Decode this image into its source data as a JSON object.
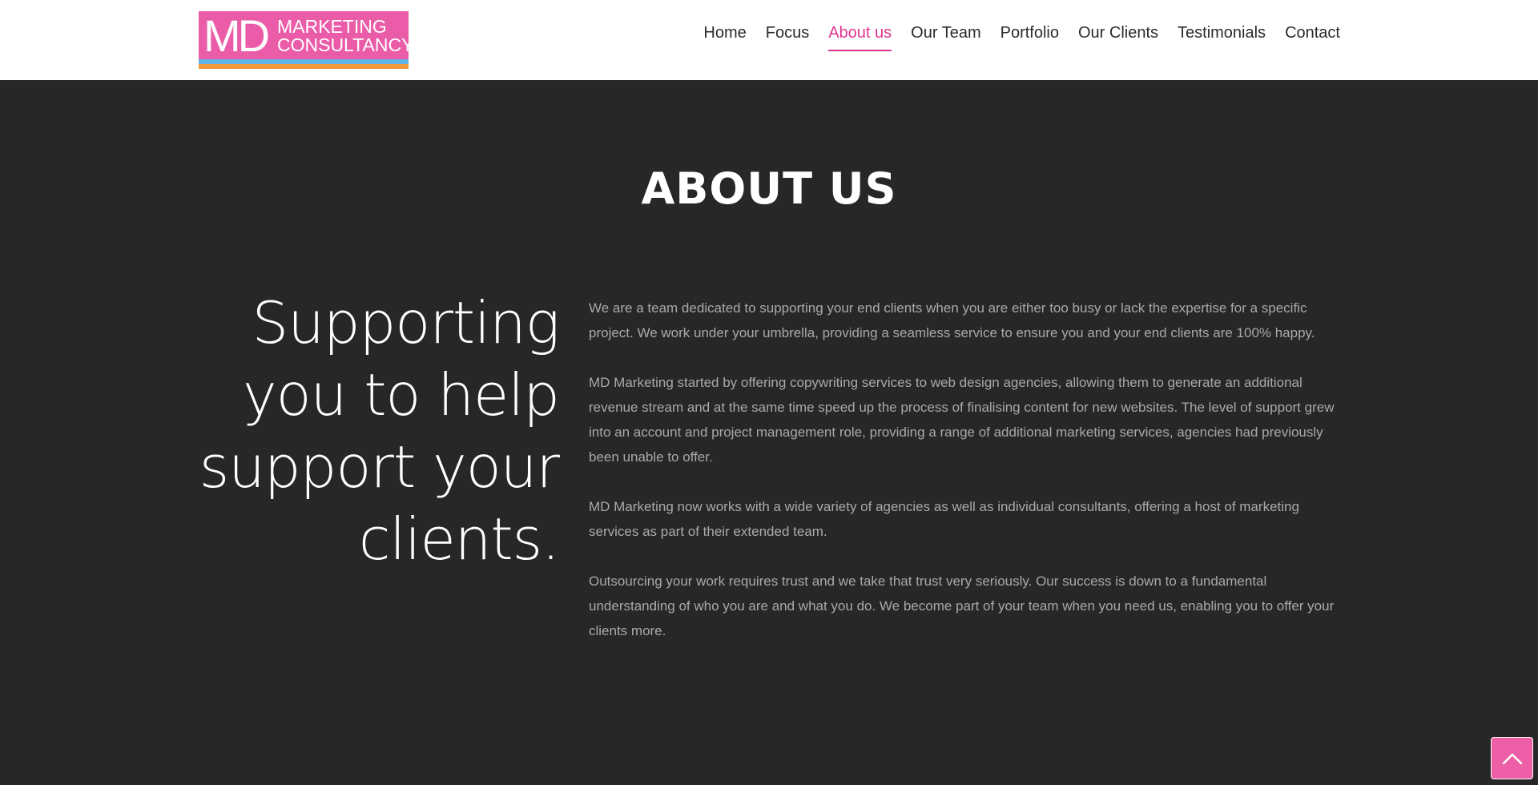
{
  "header": {
    "logo": {
      "big_text": "MD",
      "line1": "MARKETING",
      "line2": "CONSULTANCY"
    },
    "nav": [
      {
        "label": "Home",
        "active": false
      },
      {
        "label": "Focus",
        "active": false
      },
      {
        "label": "About us",
        "active": true
      },
      {
        "label": "Our Team",
        "active": false
      },
      {
        "label": "Portfolio",
        "active": false
      },
      {
        "label": "Our Clients",
        "active": false
      },
      {
        "label": "Testimonials",
        "active": false
      },
      {
        "label": "Contact",
        "active": false
      }
    ]
  },
  "about": {
    "title": "ABOUT US",
    "tagline_lines": [
      "Supporting",
      "you to help",
      "support your",
      "clients."
    ],
    "paragraphs": [
      "We are a team dedicated to supporting your end clients when you are either too busy or lack the expertise for a specific project. We work under your umbrella, providing a seamless service to ensure you and your end clients are 100% happy.",
      "MD Marketing started by offering copywriting services to web design agencies, allowing them to generate an additional revenue stream and at the same time speed up the process of finalising content for new websites. The level of support grew into an account and project management role, providing a range of additional marketing services, agencies had previously been unable to offer.",
      "MD Marketing now works with a wide variety of agencies as well as individual consultants, offering a host of marketing services as part of their extended team.",
      "Outsourcing your work requires trust and we take that trust very seriously. Our success is down to a fundamental understanding of who you are and what you do. We become part of your team when you need us, enabling you to offer your clients more."
    ]
  },
  "back_to_top": {
    "icon": "chevron-up-icon"
  },
  "colors": {
    "accent": "#e0338f",
    "logo_pink": "#ea5ca8",
    "logo_blue": "#5fb3e6",
    "logo_orange": "#f39a3a",
    "section_bg": "#272727",
    "body_text": "#a9a9a9"
  }
}
